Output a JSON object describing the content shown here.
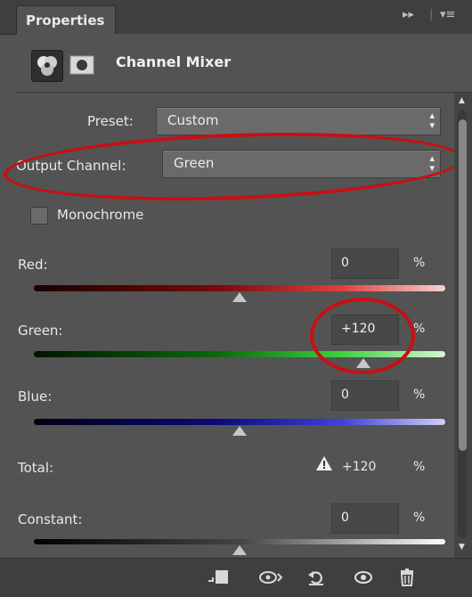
{
  "panel": {
    "tab_label": "Properties",
    "title": "Channel Mixer"
  },
  "preset": {
    "label": "Preset:",
    "value": "Custom"
  },
  "output_channel": {
    "label": "Output Channel:",
    "value": "Green"
  },
  "monochrome": {
    "label": "Monochrome",
    "checked": false
  },
  "channels": [
    {
      "label": "Red:",
      "value": "0",
      "unit": "%",
      "slider_value": 0
    },
    {
      "label": "Green:",
      "value": "+120",
      "unit": "%",
      "slider_value": 120
    },
    {
      "label": "Blue:",
      "value": "0",
      "unit": "%",
      "slider_value": 0
    }
  ],
  "total": {
    "label": "Total:",
    "value": "+120",
    "unit": "%",
    "warning_icon": "warning-triangle-icon"
  },
  "constant": {
    "label": "Constant:",
    "value": "0",
    "unit": "%",
    "slider_value": 0
  },
  "slider_range": [
    -200,
    200
  ],
  "icons": {
    "collapse": "double-chevron-icon",
    "menu": "panel-menu-icon",
    "adjustment": "channel-mixer-icon",
    "mask": "mask-icon",
    "clip": "clip-to-layer-icon",
    "view_previous": "view-previous-icon",
    "reset": "reset-icon",
    "visibility": "eye-icon",
    "delete": "trash-icon"
  },
  "colors": {
    "panel_bg": "#535353",
    "annotation_red": "#c80f14"
  }
}
